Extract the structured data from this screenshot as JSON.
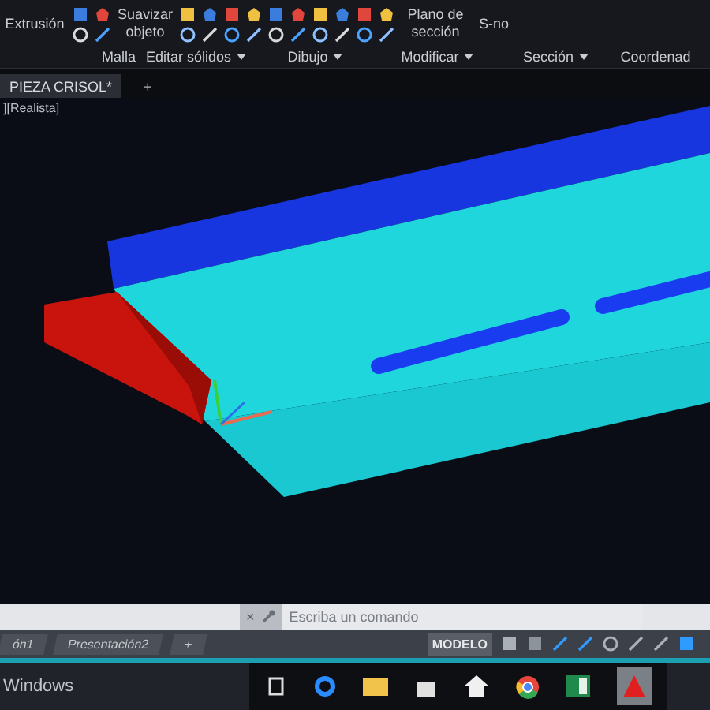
{
  "ribbon": {
    "buttons": [
      {
        "label": "Extrusión"
      },
      {
        "label": "Suavizar objeto"
      },
      {
        "label": "Plano de sección"
      },
      {
        "label": "S-no"
      }
    ],
    "panels": [
      {
        "label": "Malla",
        "dropdown": false
      },
      {
        "label": "Editar sólidos",
        "dropdown": true
      },
      {
        "label": "Dibujo",
        "dropdown": true
      },
      {
        "label": "Modificar",
        "dropdown": true
      },
      {
        "label": "Sección",
        "dropdown": true
      },
      {
        "label": "Coordenad",
        "dropdown": false
      }
    ]
  },
  "document_tabs": [
    {
      "label": "PIEZA CRISOL*",
      "selected": true
    },
    {
      "label": "+",
      "selected": false
    }
  ],
  "viewport": {
    "label": "][Realista]"
  },
  "command_line": {
    "close": "×",
    "placeholder": "Escriba un comando"
  },
  "layout_tabs": [
    {
      "label": "ón1"
    },
    {
      "label": "Presentación2"
    },
    {
      "label": "+"
    }
  ],
  "status_bar": {
    "mode": "MODELO"
  },
  "taskbar": {
    "notice": "Windows"
  }
}
